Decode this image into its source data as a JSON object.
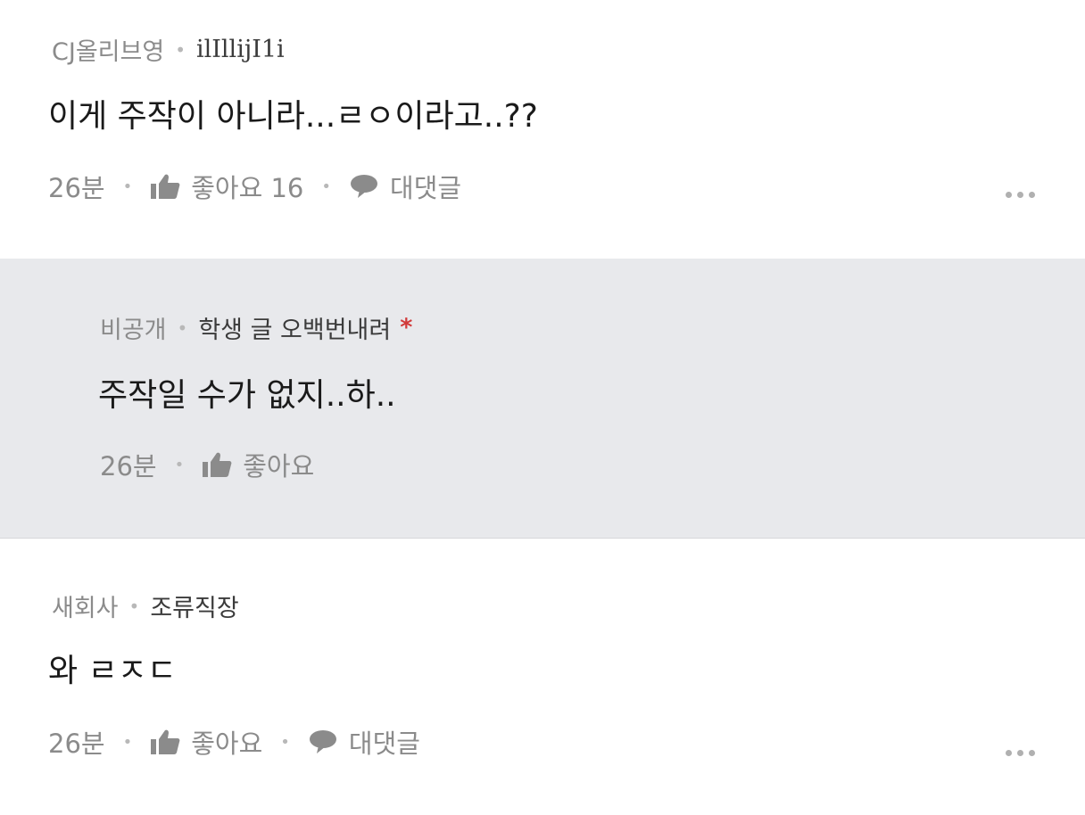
{
  "comments": [
    {
      "company": "CJ올리브영",
      "nickname": "ilIllijI1i",
      "text": "이게 주작이 아니라...ㄹㅇ이라고..??",
      "time": "26분",
      "like_label": "좋아요 16",
      "reply_label": "대댓글"
    },
    {
      "company": "비공개",
      "nickname": "학생 글 오백번내려",
      "author_mark": "*",
      "text": "주작일 수가 없지..하..",
      "time": "26분",
      "like_label": "좋아요"
    },
    {
      "company": "새회사",
      "nickname": "조류직장",
      "text": "와 ㄹㅈㄷ",
      "time": "26분",
      "like_label": "좋아요",
      "reply_label": "대댓글"
    }
  ],
  "icons": {
    "like": "thumbs-up-icon",
    "reply": "speech-bubble-icon",
    "more": "more-options-icon"
  },
  "colors": {
    "reply_background": "#e8e9ec",
    "meta_text": "#8b8b8b",
    "author_mark": "#d13a3a"
  }
}
